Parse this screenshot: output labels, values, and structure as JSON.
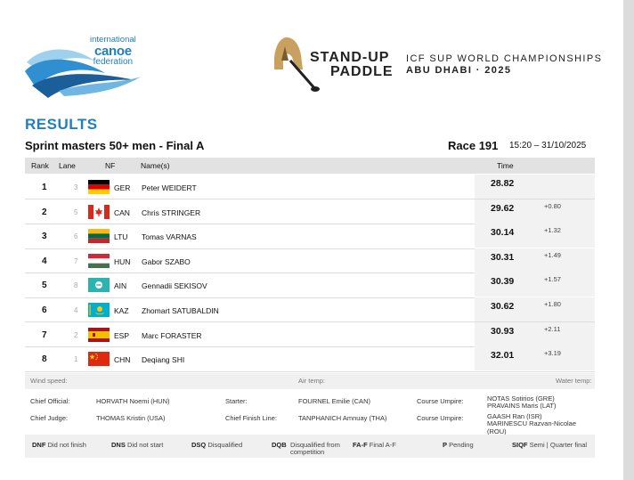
{
  "header": {
    "icf_line1": "international",
    "icf_line2": "canoe",
    "icf_line3": "federation",
    "sup_line1": "STAND-UP",
    "sup_line2": "PADDLE",
    "champ_line1": "ICF SUP WORLD CHAMPIONSHIPS",
    "champ_line2": "ABU DHABI · 2025"
  },
  "results_title": "RESULTS",
  "event": "Sprint masters 50+ men - Final A",
  "race": "Race 191",
  "race_time": "15:20 – 31/10/2025",
  "columns": {
    "rank": "Rank",
    "lane": "Lane",
    "nf": "NF",
    "name": "Name(s)",
    "time": "Time"
  },
  "rows": [
    {
      "rank": "1",
      "lane": "3",
      "nf": "GER",
      "name": "Peter WEIDERT",
      "time": "28.82",
      "diff": ""
    },
    {
      "rank": "2",
      "lane": "5",
      "nf": "CAN",
      "name": "Chris STRINGER",
      "time": "29.62",
      "diff": "+0.80"
    },
    {
      "rank": "3",
      "lane": "6",
      "nf": "LTU",
      "name": "Tomas VARNAS",
      "time": "30.14",
      "diff": "+1.32"
    },
    {
      "rank": "4",
      "lane": "7",
      "nf": "HUN",
      "name": "Gabor SZABO",
      "time": "30.31",
      "diff": "+1.49"
    },
    {
      "rank": "5",
      "lane": "8",
      "nf": "AIN",
      "name": "Gennadii SEKISOV",
      "time": "30.39",
      "diff": "+1.57"
    },
    {
      "rank": "6",
      "lane": "4",
      "nf": "KAZ",
      "name": "Zhomart SATUBALDIN",
      "time": "30.62",
      "diff": "+1.80"
    },
    {
      "rank": "7",
      "lane": "2",
      "nf": "ESP",
      "name": "Marc FORASTER",
      "time": "30.93",
      "diff": "+2.11"
    },
    {
      "rank": "8",
      "lane": "1",
      "nf": "CHN",
      "name": "Deqiang SHI",
      "time": "32.01",
      "diff": "+3.19"
    }
  ],
  "weather": {
    "wind": "Wind speed:",
    "air": "Air temp:",
    "water": "Water temp:"
  },
  "officials": {
    "chief_official_label": "Chief Official:",
    "chief_official": "HORVATH Noemi (HUN)",
    "starter_label": "Starter:",
    "starter": "FOURNEL Emilie (CAN)",
    "umpire1_label": "Course Umpire:",
    "umpire1a": "NOTAS Sotirios (GRE)",
    "umpire1b": "PRAVAINS Maris (LAT)",
    "chief_judge_label": "Chief Judge:",
    "chief_judge": "THOMAS Kristin (USA)",
    "finish_label": "Chief Finish Line:",
    "finish": "TANPHANICH Amnuay (THA)",
    "umpire2_label": "Course Umpire:",
    "umpire2a": "GAASH Ran (ISR)",
    "umpire2b": "MARINESCU Razvan-Nicolae (ROU)"
  },
  "legend": [
    {
      "code": "DNF",
      "text": "Did not finish"
    },
    {
      "code": "DNS",
      "text": "Did not start"
    },
    {
      "code": "DSQ",
      "text": "Disqualified"
    },
    {
      "code": "DQB",
      "text": "Disqualified from",
      "text2": "competition"
    },
    {
      "code": "FA-F",
      "text": "Final A-F"
    },
    {
      "code": "P",
      "text": "Pending"
    },
    {
      "code": "SIQF",
      "text": "Semi | Quarter final"
    }
  ],
  "colors": {
    "accent": "#1f7fbf",
    "header_bg": "#e2e2e2"
  }
}
